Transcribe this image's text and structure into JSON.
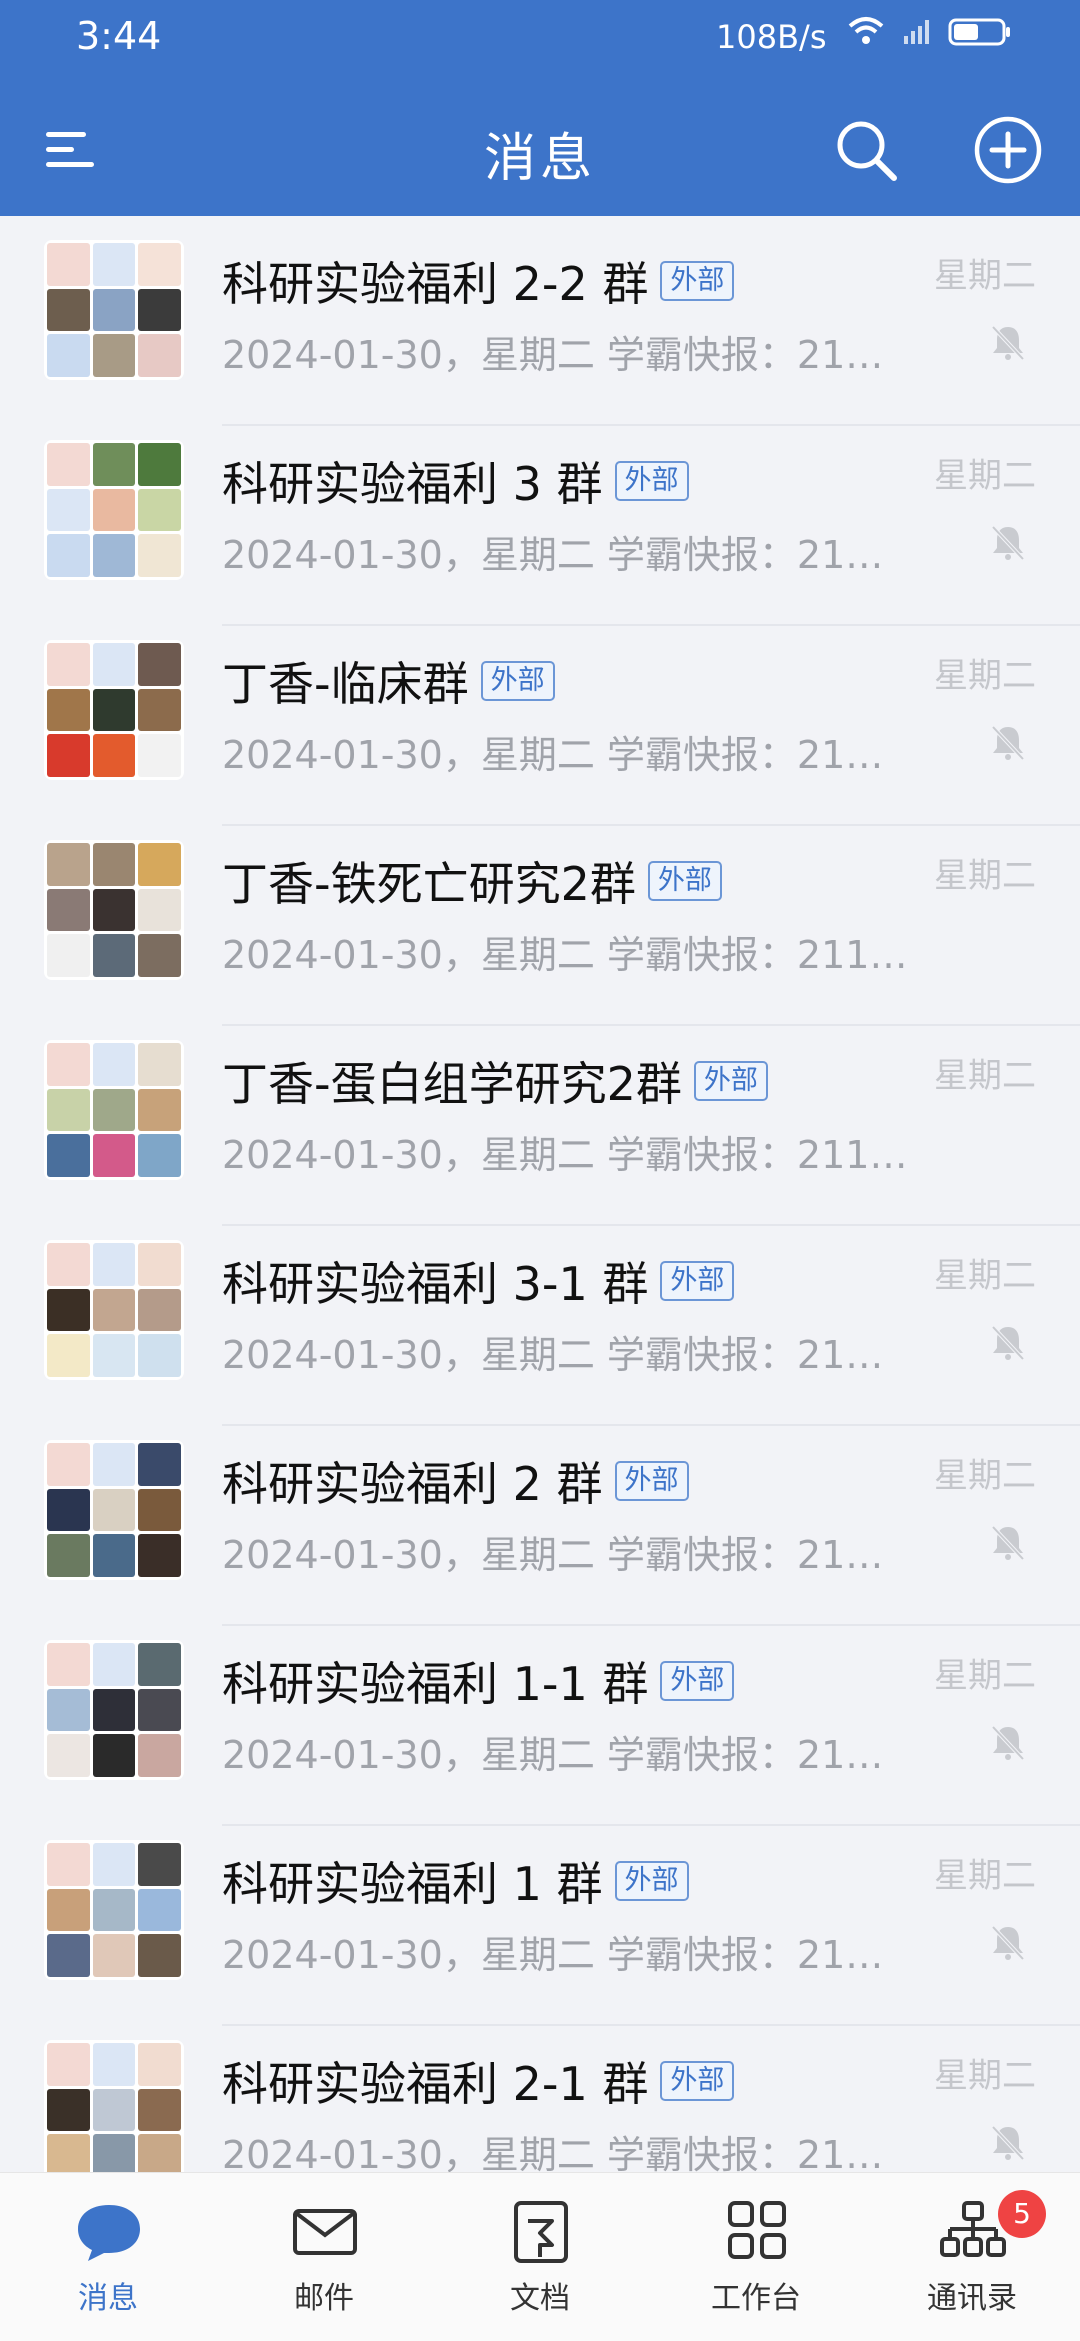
{
  "status_bar": {
    "time": "3:44",
    "speed": "108B/s"
  },
  "header": {
    "title": "消息"
  },
  "conversations": [
    {
      "name": "科研实验福利 2-2 群",
      "tag": "外部",
      "preview": "2024-01-30，星期二  学霸快报：21…",
      "day": "星期二",
      "muted": true
    },
    {
      "name": "科研实验福利 3 群",
      "tag": "外部",
      "preview": "2024-01-30，星期二  学霸快报：21…",
      "day": "星期二",
      "muted": true
    },
    {
      "name": "丁香-临床群",
      "tag": "外部",
      "preview": "2024-01-30，星期二  学霸快报：21…",
      "day": "星期二",
      "muted": true
    },
    {
      "name": "丁香-铁死亡研究2群",
      "tag": "外部",
      "preview": "2024-01-30，星期二  学霸快报：211…",
      "day": "星期二",
      "muted": false
    },
    {
      "name": "丁香-蛋白组学研究2群",
      "tag": "外部",
      "preview": "2024-01-30，星期二  学霸快报：211…",
      "day": "星期二",
      "muted": false
    },
    {
      "name": "科研实验福利 3-1 群",
      "tag": "外部",
      "preview": "2024-01-30，星期二  学霸快报：21…",
      "day": "星期二",
      "muted": true
    },
    {
      "name": "科研实验福利 2 群",
      "tag": "外部",
      "preview": "2024-01-30，星期二  学霸快报：21…",
      "day": "星期二",
      "muted": true
    },
    {
      "name": "科研实验福利 1-1 群",
      "tag": "外部",
      "preview": "2024-01-30，星期二  学霸快报：21…",
      "day": "星期二",
      "muted": true
    },
    {
      "name": "科研实验福利 1 群",
      "tag": "外部",
      "preview": "2024-01-30，星期二  学霸快报：21…",
      "day": "星期二",
      "muted": true
    },
    {
      "name": "科研实验福利 2-1 群",
      "tag": "外部",
      "preview": "2024-01-30，星期二  学霸快报：21…",
      "day": "星期二",
      "muted": true
    }
  ],
  "tabs": [
    {
      "label": "消息",
      "icon": "chat-bubble-icon",
      "active": true
    },
    {
      "label": "邮件",
      "icon": "envelope-icon",
      "active": false
    },
    {
      "label": "文档",
      "icon": "document-icon",
      "active": false
    },
    {
      "label": "工作台",
      "icon": "grid-icon",
      "active": false
    },
    {
      "label": "通讯录",
      "icon": "org-chart-icon",
      "active": false
    }
  ],
  "contacts_badge": "5",
  "colors": {
    "primary": "#3d74c9",
    "background": "#f2f3f7",
    "badge": "#ef4343"
  }
}
